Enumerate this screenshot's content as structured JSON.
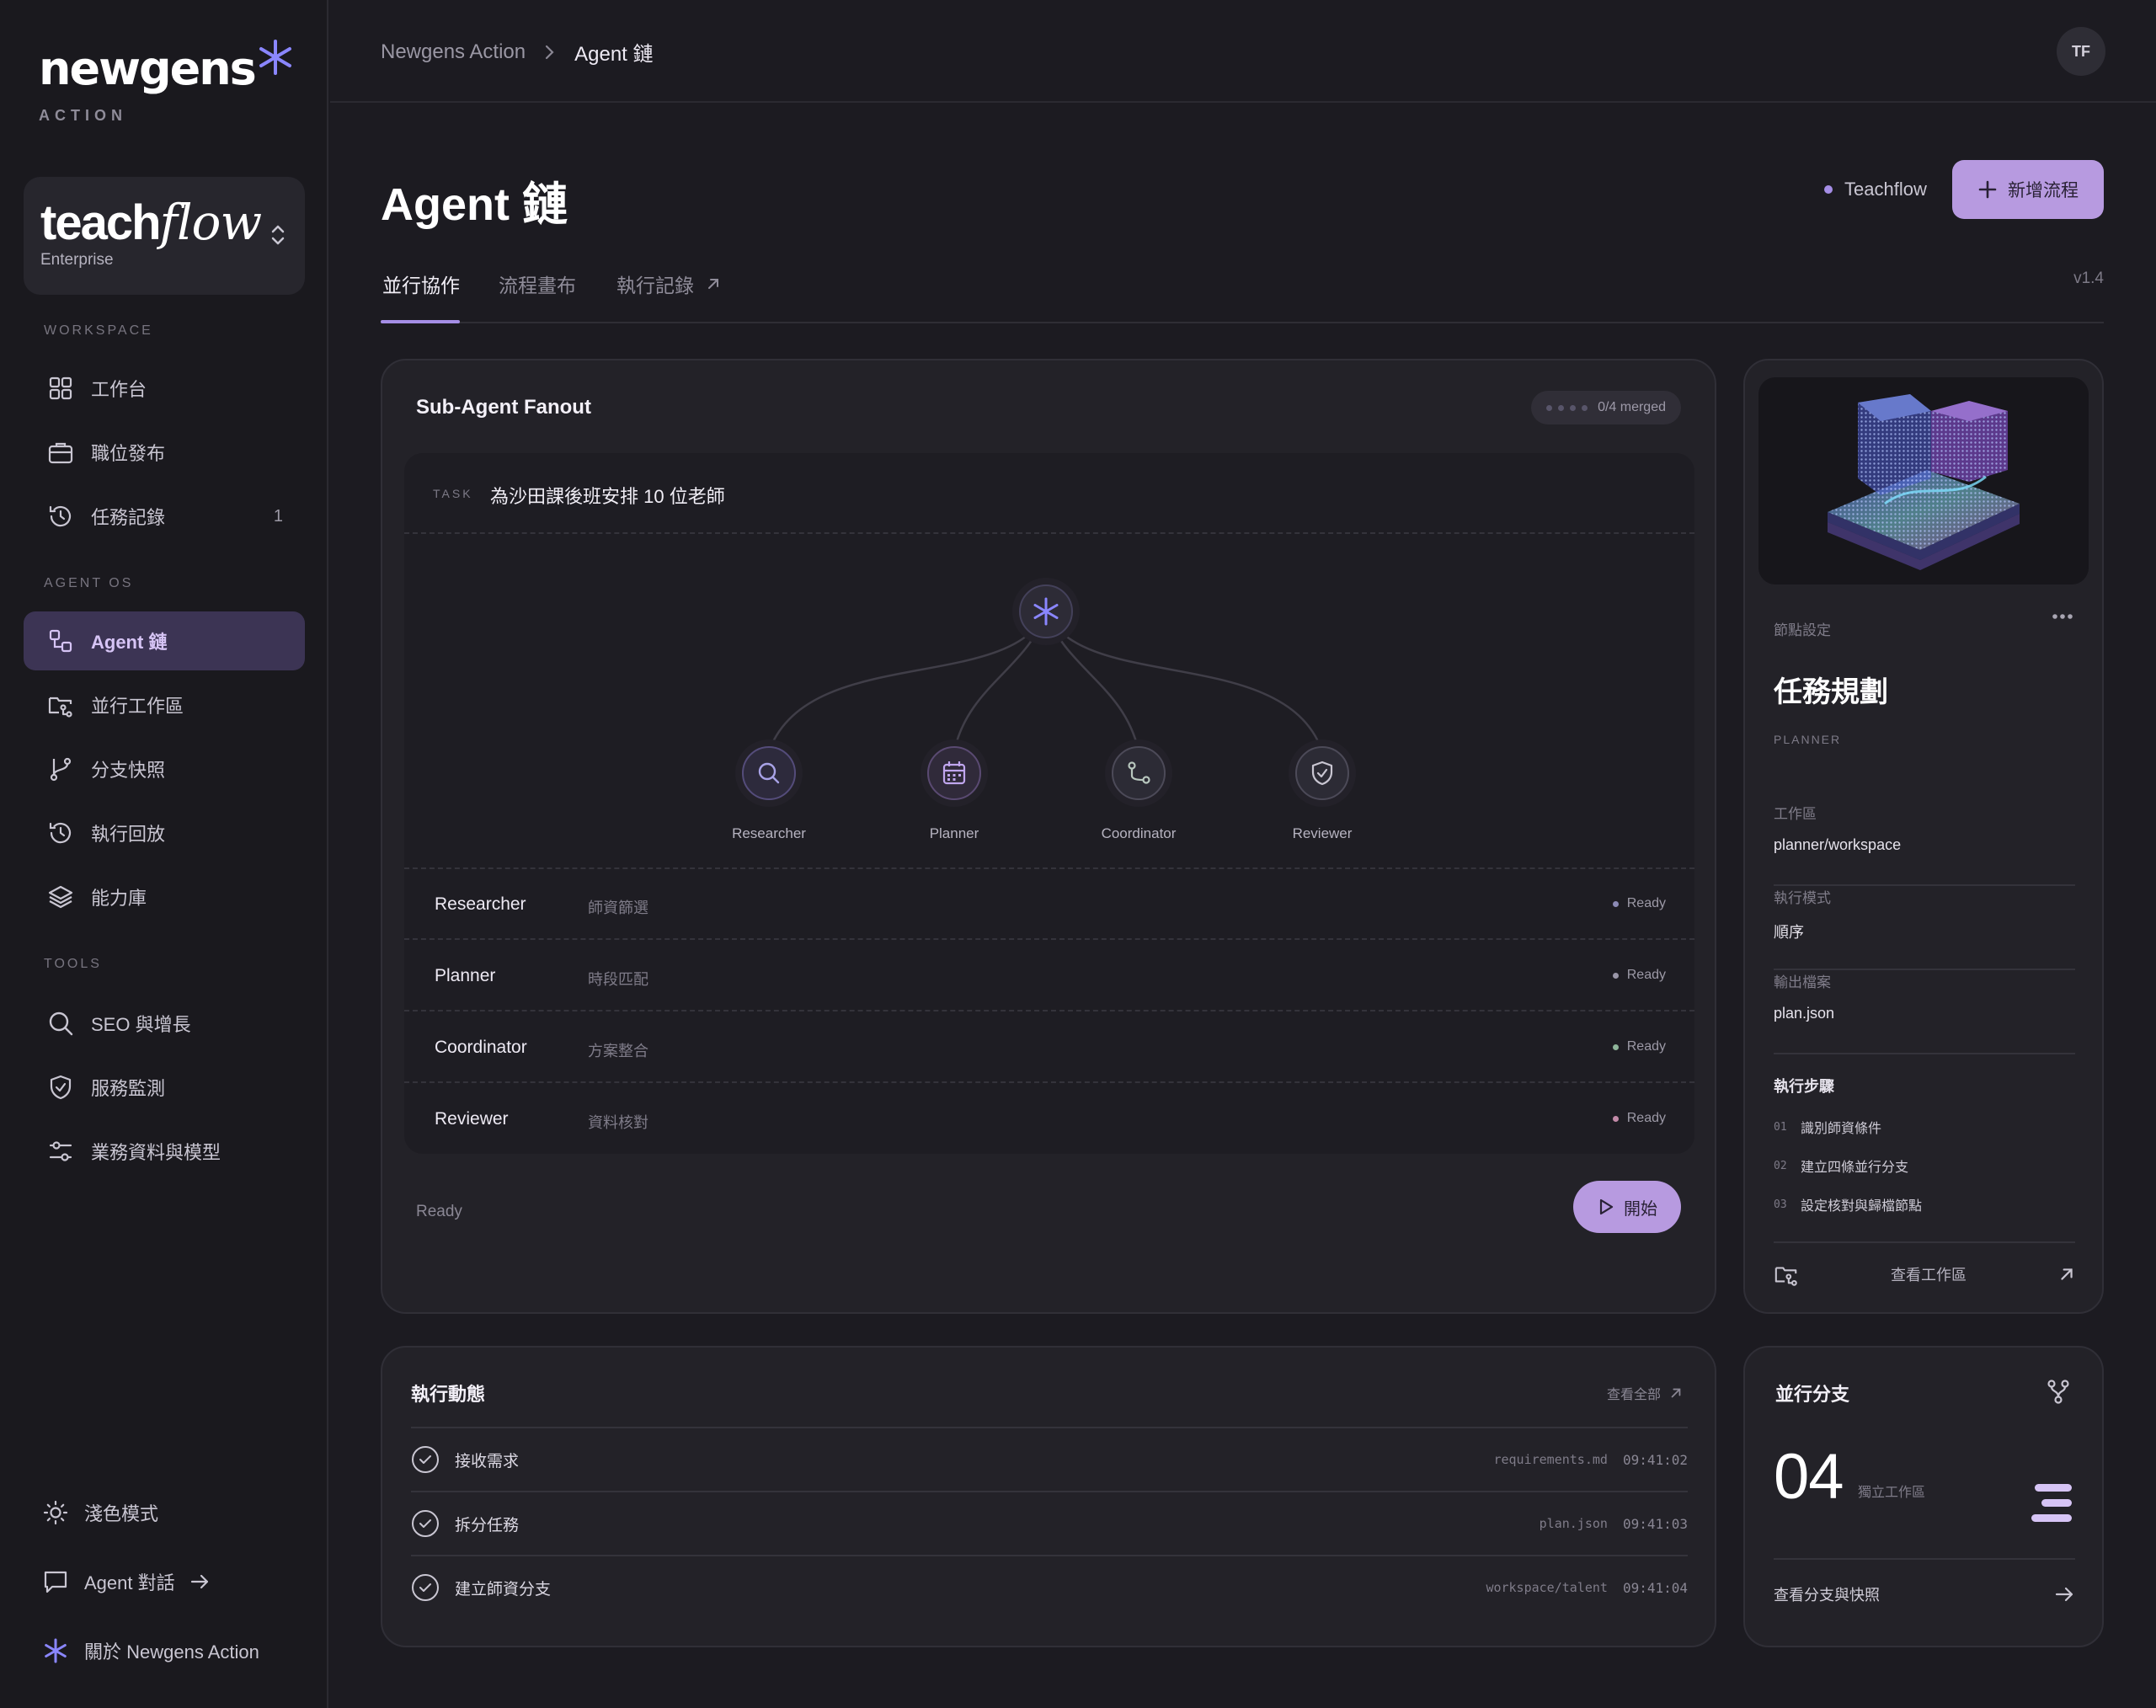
{
  "brand": {
    "name": "newgens",
    "sub": "ACTION"
  },
  "org": {
    "name_plain": "teach",
    "name_italic": "flow",
    "plan": "Enterprise"
  },
  "sidebar": {
    "sections": {
      "workspace": "WORKSPACE",
      "agent_os": "AGENT OS",
      "tools": "TOOLS"
    },
    "items": [
      {
        "label": "工作台",
        "icon": "grid-icon"
      },
      {
        "label": "職位發布",
        "icon": "briefcase-icon"
      },
      {
        "label": "任務記錄",
        "icon": "history-icon",
        "count": "1"
      },
      {
        "label": "Agent 鏈",
        "icon": "agent-chain-icon",
        "active": true
      },
      {
        "label": "並行工作區",
        "icon": "folder-branch-icon"
      },
      {
        "label": "分支快照",
        "icon": "git-branch-icon"
      },
      {
        "label": "執行回放",
        "icon": "replay-icon"
      },
      {
        "label": "能力庫",
        "icon": "layers-icon"
      },
      {
        "label": "SEO 與增長",
        "icon": "search-icon"
      },
      {
        "label": "服務監測",
        "icon": "shield-icon"
      },
      {
        "label": "業務資料與模型",
        "icon": "sliders-icon"
      }
    ],
    "bottom": [
      {
        "label": "淺色模式",
        "icon": "sun-icon"
      },
      {
        "label": "Agent 對話",
        "icon": "chat-icon"
      },
      {
        "label": "關於 Newgens Action",
        "icon": "sparkle-icon"
      }
    ]
  },
  "topbar": {
    "crumb_root": "Newgens Action",
    "crumb_current": "Agent 鏈",
    "avatar": "TF"
  },
  "header": {
    "title": "Agent 鏈",
    "project": "Teachflow",
    "new_button": "新增流程"
  },
  "tabs": [
    {
      "label": "並行協作",
      "active": true
    },
    {
      "label": "流程畫布"
    },
    {
      "label": "執行記錄"
    }
  ],
  "version": "v1.4",
  "fanout": {
    "title": "Sub-Agent Fanout",
    "merged": "0/4 merged",
    "task_label": "TASK",
    "task": "為沙田課後班安排 10 位老師",
    "nodes": [
      "Researcher",
      "Planner",
      "Coordinator",
      "Reviewer"
    ],
    "agents": [
      {
        "name": "Researcher",
        "role": "師資篩選",
        "status": "Ready",
        "color": "#8c8ab5"
      },
      {
        "name": "Planner",
        "role": "時段匹配",
        "status": "Ready",
        "color": "#9a96a8"
      },
      {
        "name": "Coordinator",
        "role": "方案整合",
        "status": "Ready",
        "color": "#8fb59a"
      },
      {
        "name": "Reviewer",
        "role": "資料核對",
        "status": "Ready",
        "color": "#c28aa8"
      }
    ],
    "footer_status": "Ready",
    "start_button": "開始"
  },
  "config": {
    "section": "節點設定",
    "title": "任務規劃",
    "subtitle": "PLANNER",
    "fields": [
      {
        "k": "工作區",
        "v": "planner/workspace"
      },
      {
        "k": "執行模式",
        "v": "順序"
      },
      {
        "k": "輸出檔案",
        "v": "plan.json"
      }
    ],
    "steps_title": "執行步驟",
    "steps": [
      {
        "n": "01",
        "text": "識別師資條件"
      },
      {
        "n": "02",
        "text": "建立四條並行分支"
      },
      {
        "n": "03",
        "text": "設定核對與歸檔節點"
      }
    ],
    "footer": "查看工作區"
  },
  "activity": {
    "title": "執行動態",
    "view_all": "查看全部",
    "rows": [
      {
        "name": "接收需求",
        "file": "requirements.md",
        "time": "09:41:02"
      },
      {
        "name": "拆分任務",
        "file": "plan.json",
        "time": "09:41:03"
      },
      {
        "name": "建立師資分支",
        "file": "workspace/talent",
        "time": "09:41:04"
      }
    ]
  },
  "branches": {
    "title": "並行分支",
    "count": "04",
    "note": "獨立工作區",
    "footer": "查看分支與快照"
  },
  "colors": {
    "accent": "#b79ae0",
    "active_nav": "#3c3454",
    "background": "#1c1b21"
  }
}
